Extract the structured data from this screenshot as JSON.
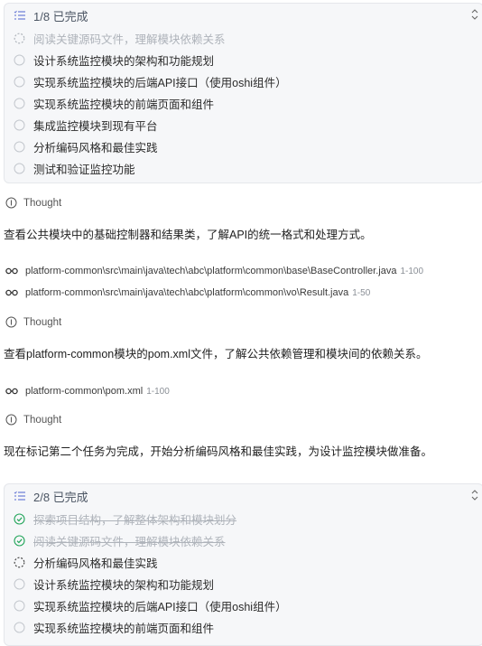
{
  "panel1": {
    "title": "1/8 已完成",
    "tasks": [
      {
        "label": "阅读关键源码文件，理解模块依赖关系",
        "state": "in-progress-dim"
      },
      {
        "label": "设计系统监控模块的架构和功能规划",
        "state": "pending"
      },
      {
        "label": "实现系统监控模块的后端API接口（使用oshi组件）",
        "state": "pending"
      },
      {
        "label": "实现系统监控模块的前端页面和组件",
        "state": "pending"
      },
      {
        "label": "集成监控模块到现有平台",
        "state": "pending"
      },
      {
        "label": "分析编码风格和最佳实践",
        "state": "pending"
      },
      {
        "label": "测试和验证监控功能",
        "state": "pending"
      }
    ]
  },
  "thought_label": "Thought",
  "para1": "查看公共模块中的基础控制器和结果类，了解API的统一格式和处理方式。",
  "files1": [
    {
      "path": "platform-common\\src\\main\\java\\tech\\abc\\platform\\common\\base\\BaseController.java",
      "range": "1-100"
    },
    {
      "path": "platform-common\\src\\main\\java\\tech\\abc\\platform\\common\\vo\\Result.java",
      "range": "1-50"
    }
  ],
  "para2": "查看platform-common模块的pom.xml文件，了解公共依赖管理和模块间的依赖关系。",
  "files2": [
    {
      "path": "platform-common\\pom.xml",
      "range": "1-100"
    }
  ],
  "para3": "现在标记第二个任务为完成，开始分析编码风格和最佳实践，为设计监控模块做准备。",
  "panel2": {
    "title": "2/8 已完成",
    "tasks": [
      {
        "label": "探索项目结构，了解整体架构和模块划分",
        "state": "done"
      },
      {
        "label": "阅读关键源码文件，理解模块依赖关系",
        "state": "done"
      },
      {
        "label": "分析编码风格和最佳实践",
        "state": "in-progress"
      },
      {
        "label": "设计系统监控模块的架构和功能规划",
        "state": "pending"
      },
      {
        "label": "实现系统监控模块的后端API接口（使用oshi组件）",
        "state": "pending"
      },
      {
        "label": "实现系统监控模块的前端页面和组件",
        "state": "pending"
      }
    ]
  },
  "colors": {
    "done_green": "#22a55a",
    "muted": "#aeb3ba",
    "accent": "#6b7cd6"
  }
}
